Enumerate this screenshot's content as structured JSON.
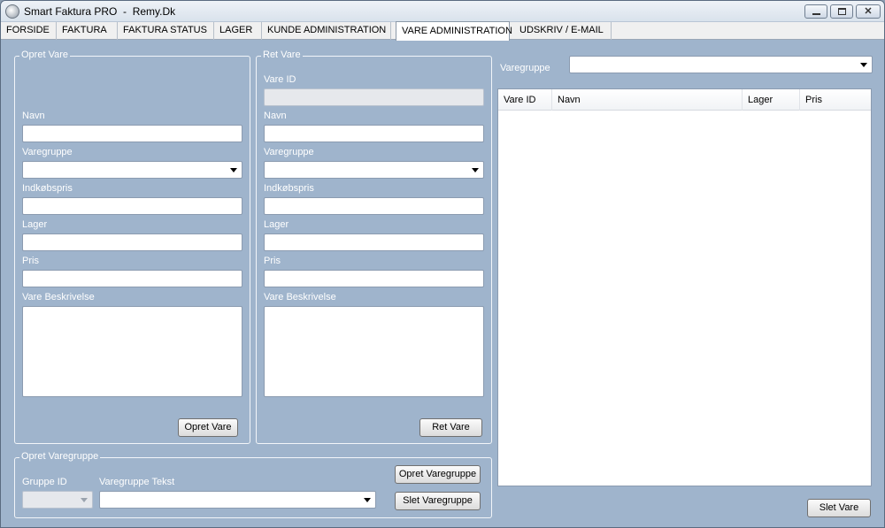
{
  "window": {
    "title": "Smart Faktura PRO  -  Remy.Dk",
    "close_glyph": "✕"
  },
  "tabs": [
    {
      "label": "FORSIDE"
    },
    {
      "label": "FAKTURA"
    },
    {
      "label": "FAKTURA STATUS"
    },
    {
      "label": "LAGER"
    },
    {
      "label": "KUNDE ADMINISTRATION"
    },
    {
      "label": "VARE ADMINISTRATION",
      "active": true
    },
    {
      "label": "UDSKRIV / E-MAIL"
    }
  ],
  "opret_vare": {
    "legend": "Opret Vare",
    "navn_label": "Navn",
    "navn_value": "",
    "varegruppe_label": "Varegruppe",
    "varegruppe_value": "",
    "indkobspris_label": "Indkøbspris",
    "indkobspris_value": "",
    "lager_label": "Lager",
    "lager_value": "",
    "pris_label": "Pris",
    "pris_value": "",
    "beskrivelse_label": "Vare Beskrivelse",
    "beskrivelse_value": "",
    "button_label": "Opret Vare"
  },
  "ret_vare": {
    "legend": "Ret Vare",
    "vare_id_label": "Vare ID",
    "vare_id_value": "",
    "navn_label": "Navn",
    "navn_value": "",
    "varegruppe_label": "Varegruppe",
    "varegruppe_value": "",
    "indkobspris_label": "Indkøbspris",
    "indkobspris_value": "",
    "lager_label": "Lager",
    "lager_value": "",
    "pris_label": "Pris",
    "pris_value": "",
    "beskrivelse_label": "Vare Beskrivelse",
    "beskrivelse_value": "",
    "button_label": "Ret Vare"
  },
  "opret_varegruppe": {
    "legend": "Opret Varegruppe",
    "gruppe_id_label": "Gruppe ID",
    "gruppe_id_value": "",
    "tekst_label": "Varegruppe Tekst",
    "tekst_value": "",
    "opret_button_label": "Opret Varegruppe",
    "slet_button_label": "Slet Varegruppe"
  },
  "filter": {
    "varegruppe_label": "Varegruppe",
    "varegruppe_value": ""
  },
  "list": {
    "columns": [
      "Vare ID",
      "Navn",
      "Lager",
      "Pris"
    ],
    "rows": []
  },
  "slet_vare_button_label": "Slet Vare"
}
